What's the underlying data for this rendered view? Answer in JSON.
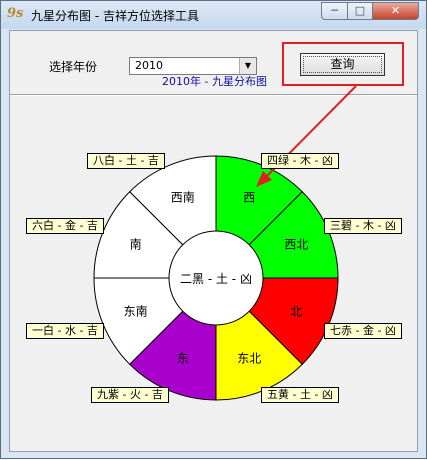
{
  "window": {
    "title": "九星分布图 - 吉祥方位选择工具",
    "app_icon_text": "9s"
  },
  "controls": {
    "min": "─",
    "max": "□",
    "close": "✕"
  },
  "form": {
    "year_label": "选择年份",
    "year_value": "2010",
    "query_label": "查询"
  },
  "chart": {
    "title": "2010年 - 九星分布图",
    "center_label": "二黑 - 土 - 凶",
    "sectors": [
      {
        "direction": "西",
        "color": "#00ff00"
      },
      {
        "direction": "西北",
        "color": "#00ff00"
      },
      {
        "direction": "北",
        "color": "#ff0000"
      },
      {
        "direction": "东北",
        "color": "#ffff00"
      },
      {
        "direction": "东",
        "color": "#aa00cc"
      },
      {
        "direction": "东南",
        "color": "#ffffff"
      },
      {
        "direction": "南",
        "color": "#ffffff"
      },
      {
        "direction": "西南",
        "color": "#ffffff"
      }
    ],
    "tags": [
      {
        "id": "tag-bazhi",
        "text": "八白 - 土 - 吉"
      },
      {
        "id": "tag-sihu",
        "text": "四绿 - 木 - 凶"
      },
      {
        "id": "tag-liubai",
        "text": "六白 - 金 - 吉"
      },
      {
        "id": "tag-sanbi",
        "text": "三碧 - 木 - 凶"
      },
      {
        "id": "tag-yibai",
        "text": "一白 - 水 - 吉"
      },
      {
        "id": "tag-qichi",
        "text": "七赤 - 金 - 凶"
      },
      {
        "id": "tag-jiuzi",
        "text": "九紫 - 火 - 吉"
      },
      {
        "id": "tag-wuhuang",
        "text": "五黄 - 土 - 凶"
      }
    ]
  }
}
